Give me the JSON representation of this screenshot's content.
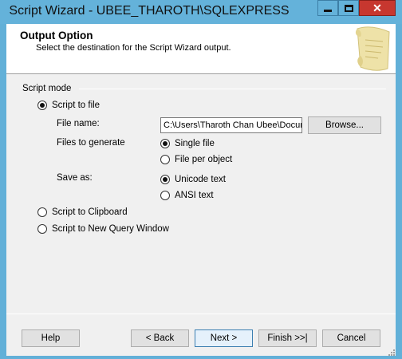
{
  "window": {
    "title": "Script Wizard - UBEE_THAROTH\\SQLEXPRESS",
    "close_glyph": "✕"
  },
  "header": {
    "title": "Output Option",
    "subtitle": "Select the destination for the Script Wizard output."
  },
  "script_mode": {
    "group_label": "Script mode",
    "to_file": {
      "label": "Script to file",
      "selected": true
    },
    "file_name_label": "File name:",
    "file_name_value": "C:\\Users\\Tharoth Chan Ubee\\Documents\\script.sql",
    "browse_label": "Browse...",
    "files_to_generate_label": "Files to generate",
    "single_file": {
      "label": "Single file",
      "selected": true
    },
    "file_per_object": {
      "label": "File per object",
      "selected": false
    },
    "save_as_label": "Save as:",
    "unicode_text": {
      "label": "Unicode text",
      "selected": true
    },
    "ansi_text": {
      "label": "ANSI text",
      "selected": false
    },
    "to_clipboard": {
      "label": "Script to Clipboard",
      "selected": false
    },
    "to_query_window": {
      "label": "Script to New Query Window",
      "selected": false
    }
  },
  "footer": {
    "help": "Help",
    "back": "< Back",
    "next": "Next >",
    "finish": "Finish >>|",
    "cancel": "Cancel"
  },
  "icons": {
    "header_icon": "scroll-icon"
  }
}
